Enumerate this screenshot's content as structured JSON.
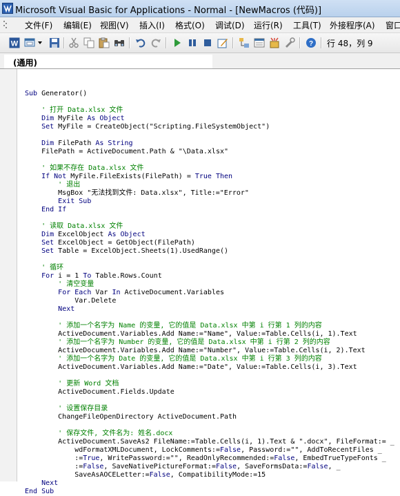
{
  "window": {
    "title": "Microsoft Visual Basic for Applications - Normal - [NewMacros (代码)]"
  },
  "menu": {
    "items": [
      {
        "label": "文件(F)",
        "name": "file"
      },
      {
        "label": "编辑(E)",
        "name": "edit"
      },
      {
        "label": "视图(V)",
        "name": "view"
      },
      {
        "label": "插入(I)",
        "name": "insert"
      },
      {
        "label": "格式(O)",
        "name": "format"
      },
      {
        "label": "调试(D)",
        "name": "debug"
      },
      {
        "label": "运行(R)",
        "name": "run"
      },
      {
        "label": "工具(T)",
        "name": "tools"
      },
      {
        "label": "外接程序(A)",
        "name": "addins"
      },
      {
        "label": "窗口",
        "name": "window"
      }
    ]
  },
  "toolbar": {
    "icons": [
      "word-icon",
      "insert-module-icon",
      "save-icon",
      "cut-icon",
      "copy-icon",
      "paste-icon",
      "find-icon",
      "undo-icon",
      "redo-icon",
      "run-icon",
      "break-icon",
      "reset-icon",
      "design-mode-icon",
      "project-explorer-icon",
      "properties-icon",
      "object-browser-icon",
      "toolbox-icon",
      "help-icon"
    ],
    "cursor_position": "行 48，列 9"
  },
  "object_box": {
    "value": "(通用)"
  },
  "code": {
    "lines": [
      [
        [
          "kw",
          "Sub"
        ],
        [
          "t",
          " Generator()"
        ]
      ],
      [],
      [
        [
          "t",
          "    "
        ],
        [
          "cm",
          "' 打开 Data.xlsx 文件"
        ]
      ],
      [
        [
          "t",
          "    "
        ],
        [
          "kw",
          "Dim"
        ],
        [
          "t",
          " MyFile "
        ],
        [
          "kw",
          "As Object"
        ]
      ],
      [
        [
          "t",
          "    "
        ],
        [
          "kw",
          "Set"
        ],
        [
          "t",
          " MyFile = CreateObject(\"Scripting.FileSystemObject\")"
        ]
      ],
      [],
      [
        [
          "t",
          "    "
        ],
        [
          "kw",
          "Dim"
        ],
        [
          "t",
          " FilePath "
        ],
        [
          "kw",
          "As String"
        ]
      ],
      [
        [
          "t",
          "    FilePath = ActiveDocument.Path & \"\\Data.xlsx\""
        ]
      ],
      [],
      [
        [
          "t",
          "    "
        ],
        [
          "cm",
          "' 如果不存在 Data.xlsx 文件"
        ]
      ],
      [
        [
          "t",
          "    "
        ],
        [
          "kw",
          "If Not"
        ],
        [
          "t",
          " MyFile.FileExists(FilePath) = "
        ],
        [
          "kw",
          "True Then"
        ]
      ],
      [
        [
          "t",
          "        "
        ],
        [
          "cm",
          "' 退出"
        ]
      ],
      [
        [
          "t",
          "        MsgBox \"无法找到文件: Data.xlsx\", Title:=\"Error\""
        ]
      ],
      [
        [
          "t",
          "        "
        ],
        [
          "kw",
          "Exit Sub"
        ]
      ],
      [
        [
          "t",
          "    "
        ],
        [
          "kw",
          "End If"
        ]
      ],
      [],
      [
        [
          "t",
          "    "
        ],
        [
          "cm",
          "' 读取 Data.xlsx 文件"
        ]
      ],
      [
        [
          "t",
          "    "
        ],
        [
          "kw",
          "Dim"
        ],
        [
          "t",
          " ExcelObject "
        ],
        [
          "kw",
          "As Object"
        ]
      ],
      [
        [
          "t",
          "    "
        ],
        [
          "kw",
          "Set"
        ],
        [
          "t",
          " ExcelObject = GetObject(FilePath)"
        ]
      ],
      [
        [
          "t",
          "    "
        ],
        [
          "kw",
          "Set"
        ],
        [
          "t",
          " Table = ExcelObject.Sheets(1).UsedRange()"
        ]
      ],
      [],
      [
        [
          "t",
          "    "
        ],
        [
          "cm",
          "' 循环"
        ]
      ],
      [
        [
          "t",
          "    "
        ],
        [
          "kw",
          "For"
        ],
        [
          "t",
          " i = 1 "
        ],
        [
          "kw",
          "To"
        ],
        [
          "t",
          " Table.Rows.Count"
        ]
      ],
      [
        [
          "t",
          "        "
        ],
        [
          "cm",
          "' 清空变量"
        ]
      ],
      [
        [
          "t",
          "        "
        ],
        [
          "kw",
          "For Each"
        ],
        [
          "t",
          " Var "
        ],
        [
          "kw",
          "In"
        ],
        [
          "t",
          " ActiveDocument.Variables"
        ]
      ],
      [
        [
          "t",
          "            Var.Delete"
        ]
      ],
      [
        [
          "t",
          "        "
        ],
        [
          "kw",
          "Next"
        ]
      ],
      [],
      [
        [
          "t",
          "        "
        ],
        [
          "cm",
          "' 添加一个名字为 Name 的变量, 它的值是 Data.xlsx 中第 i 行第 1 列的内容"
        ]
      ],
      [
        [
          "t",
          "        ActiveDocument.Variables.Add Name:=\"Name\", Value:=Table.Cells(i, 1).Text"
        ]
      ],
      [
        [
          "t",
          "        "
        ],
        [
          "cm",
          "' 添加一个名字为 Number 的变量, 它的值是 Data.xlsx 中第 i 行第 2 列的内容"
        ]
      ],
      [
        [
          "t",
          "        ActiveDocument.Variables.Add Name:=\"Number\", Value:=Table.Cells(i, 2).Text"
        ]
      ],
      [
        [
          "t",
          "        "
        ],
        [
          "cm",
          "' 添加一个名字为 Date 的变量, 它的值是 Data.xlsx 中第 i 行第 3 列的内容"
        ]
      ],
      [
        [
          "t",
          "        ActiveDocument.Variables.Add Name:=\"Date\", Value:=Table.Cells(i, 3).Text"
        ]
      ],
      [],
      [
        [
          "t",
          "        "
        ],
        [
          "cm",
          "' 更新 Word 文档"
        ]
      ],
      [
        [
          "t",
          "        ActiveDocument.Fields.Update"
        ]
      ],
      [],
      [
        [
          "t",
          "        "
        ],
        [
          "cm",
          "' 设置保存目录"
        ]
      ],
      [
        [
          "t",
          "        ChangeFileOpenDirectory ActiveDocument.Path"
        ]
      ],
      [],
      [
        [
          "t",
          "        "
        ],
        [
          "cm",
          "' 保存文件, 文件名为: 姓名.docx"
        ]
      ],
      [
        [
          "t",
          "        ActiveDocument.SaveAs2 FileName:=Table.Cells(i, 1).Text & \".docx\", FileFormat:= _"
        ]
      ],
      [
        [
          "t",
          "            wdFormatXMLDocument, LockComments:="
        ],
        [
          "kw",
          "False"
        ],
        [
          "t",
          ", Password:=\"\", AddToRecentFiles _"
        ]
      ],
      [
        [
          "t",
          "            :="
        ],
        [
          "kw",
          "True"
        ],
        [
          "t",
          ", WritePassword:=\"\", ReadOnlyRecommended:="
        ],
        [
          "kw",
          "False"
        ],
        [
          "t",
          ", EmbedTrueTypeFonts _"
        ]
      ],
      [
        [
          "t",
          "            :="
        ],
        [
          "kw",
          "False"
        ],
        [
          "t",
          ", SaveNativePictureFormat:="
        ],
        [
          "kw",
          "False"
        ],
        [
          "t",
          ", SaveFormsData:="
        ],
        [
          "kw",
          "False"
        ],
        [
          "t",
          ", _"
        ]
      ],
      [
        [
          "t",
          "            SaveAsAOCELetter:="
        ],
        [
          "kw",
          "False"
        ],
        [
          "t",
          ", CompatibilityMode:=15"
        ]
      ],
      [
        [
          "t",
          "    "
        ],
        [
          "kw",
          "Next"
        ]
      ],
      [
        [
          "kw",
          "End Sub"
        ]
      ]
    ]
  }
}
